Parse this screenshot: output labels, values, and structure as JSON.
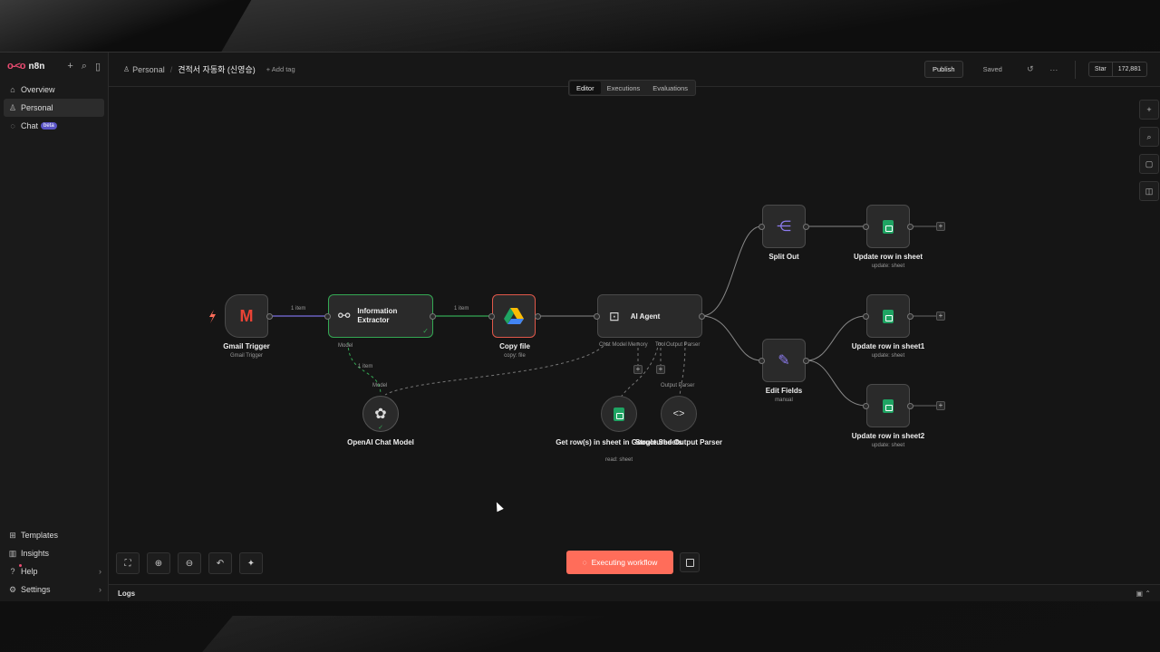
{
  "brand": {
    "name": "n8n"
  },
  "sidebar": {
    "items": [
      {
        "label": "Overview",
        "icon": "home-icon"
      },
      {
        "label": "Personal",
        "icon": "user-icon"
      },
      {
        "label": "Chat",
        "icon": "chat-icon",
        "badge": "beta"
      }
    ],
    "bottom": [
      {
        "label": "Templates",
        "icon": "templates-icon"
      },
      {
        "label": "Insights",
        "icon": "insights-icon"
      },
      {
        "label": "Help",
        "icon": "help-icon"
      },
      {
        "label": "Settings",
        "icon": "gear-icon"
      }
    ]
  },
  "header": {
    "breadcrumb_project": "Personal",
    "workflow_title": "견적서 자동화 (신영승)",
    "add_tag": "+ Add tag",
    "publish": "Publish",
    "saved": "Saved",
    "github_star": "Star",
    "github_count": "172,881"
  },
  "tabs": [
    "Editor",
    "Executions",
    "Evaluations"
  ],
  "nodes": {
    "gmail": {
      "label": "Gmail Trigger",
      "sub": "Gmail Trigger"
    },
    "extractor": {
      "label": "Information Extractor",
      "model_port": "Model"
    },
    "copy": {
      "label": "Copy file",
      "sub": "copy: file"
    },
    "agent": {
      "label": "AI Agent",
      "ports": [
        "Chat Model",
        "Memory",
        "Tool",
        "Output Parser"
      ]
    },
    "openai": {
      "label": "OpenAI Chat Model",
      "port_label": "Model"
    },
    "getrows": {
      "label": "Get row(s) in sheet in Google Sheets",
      "sub": "read: sheet"
    },
    "parser": {
      "label": "Structured Output Parser",
      "port_label": "Output Parser"
    },
    "splitout": {
      "label": "Split Out"
    },
    "editfields": {
      "label": "Edit Fields",
      "sub": "manual"
    },
    "update1": {
      "label": "Update row in sheet",
      "sub": "update: sheet"
    },
    "update2": {
      "label": "Update row in sheet1",
      "sub": "update: sheet"
    },
    "update3": {
      "label": "Update row in sheet2",
      "sub": "update: sheet"
    }
  },
  "edge_labels": {
    "e1": "1 item",
    "e2": "1 item",
    "e3": "1 item"
  },
  "execute_button": "Executing workflow",
  "logs": "Logs",
  "colors": {
    "accent": "#ff6d5a",
    "brand": "#ea4b71",
    "success": "#34a853"
  }
}
